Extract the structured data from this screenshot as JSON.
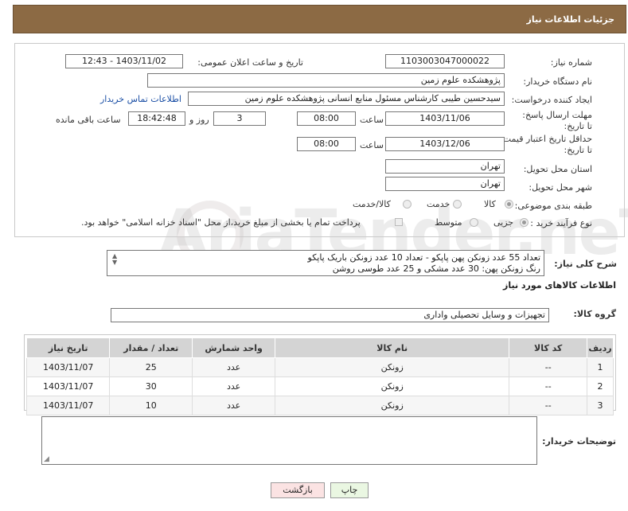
{
  "header": {
    "title": "جزئیات اطلاعات نیاز"
  },
  "form": {
    "need_number_label": "شماره نیاز:",
    "need_number": "1103003047000022",
    "announce_label": "تاریخ و ساعت اعلان عمومی:",
    "announce_value": "1403/11/02 - 12:43",
    "buyer_org_label": "نام دستگاه خریدار:",
    "buyer_org": "پژوهشکده علوم زمین",
    "requester_label": "ایجاد کننده درخواست:",
    "requester": "سیدحسین طیبی کارشناس مسئول منابع انسانی پژوهشکده علوم زمین",
    "contact_link": "اطلاعات تماس خریدار",
    "deadline_label": "مهلت ارسال پاسخ: تا تاریخ:",
    "deadline_date": "1403/11/06",
    "time_label": "ساعت",
    "deadline_time": "08:00",
    "days_value": "3",
    "days_label": "روز و",
    "remaining_time": "18:42:48",
    "remaining_label": "ساعت باقی مانده",
    "validity_label": "حداقل تاریخ اعتبار قیمت: تا تاریخ:",
    "validity_date": "1403/12/06",
    "validity_time": "08:00",
    "province_label": "استان محل تحویل:",
    "province": "تهران",
    "city_label": "شهر محل تحویل:",
    "city": "تهران",
    "category_label": "طبقه بندی موضوعی:",
    "category_options": [
      "کالا",
      "خدمت",
      "کالا/خدمت"
    ],
    "process_label": "نوع فرآیند خرید :",
    "process_options": [
      "جزیی",
      "متوسط"
    ],
    "payment_note": "پرداخت تمام یا بخشی از مبلغ خرید،از محل \"اسناد خزانه اسلامی\" خواهد بود."
  },
  "description": {
    "label": "شرح کلی نیاز:",
    "line1": "تعداد 55 عدد زونکن پهن پاپکو - تعداد 10 عدد زونکن باریک پاپکو",
    "line2": "رنگ زونکن پهن: 30 عدد مشکی و  25 عدد طوسی روشن"
  },
  "goods": {
    "section_title": "اطلاعات کالاهای مورد نیاز",
    "group_label": "گروه کالا:",
    "group_value": "تجهیزات و وسایل تحصیلی واداری",
    "columns": [
      "ردیف",
      "کد کالا",
      "نام کالا",
      "واحد شمارش",
      "تعداد / مقدار",
      "تاریخ نیاز"
    ],
    "rows": [
      {
        "row": "1",
        "code": "--",
        "name": "زونکن",
        "unit": "عدد",
        "qty": "25",
        "date": "1403/11/07"
      },
      {
        "row": "2",
        "code": "--",
        "name": "زونکن",
        "unit": "عدد",
        "qty": "30",
        "date": "1403/11/07"
      },
      {
        "row": "3",
        "code": "--",
        "name": "زونکن",
        "unit": "عدد",
        "qty": "10",
        "date": "1403/11/07"
      }
    ]
  },
  "buyer_notes": {
    "label": "توضیحات خریدار:",
    "value": ""
  },
  "buttons": {
    "print": "چاپ",
    "back": "بازگشت"
  },
  "watermark": "AriaTender.neT",
  "colors": {
    "header_bg": "#8c6a44",
    "print_btn": "#eaf7e2",
    "back_btn": "#fbe3e3",
    "link": "#1b4fa5"
  }
}
